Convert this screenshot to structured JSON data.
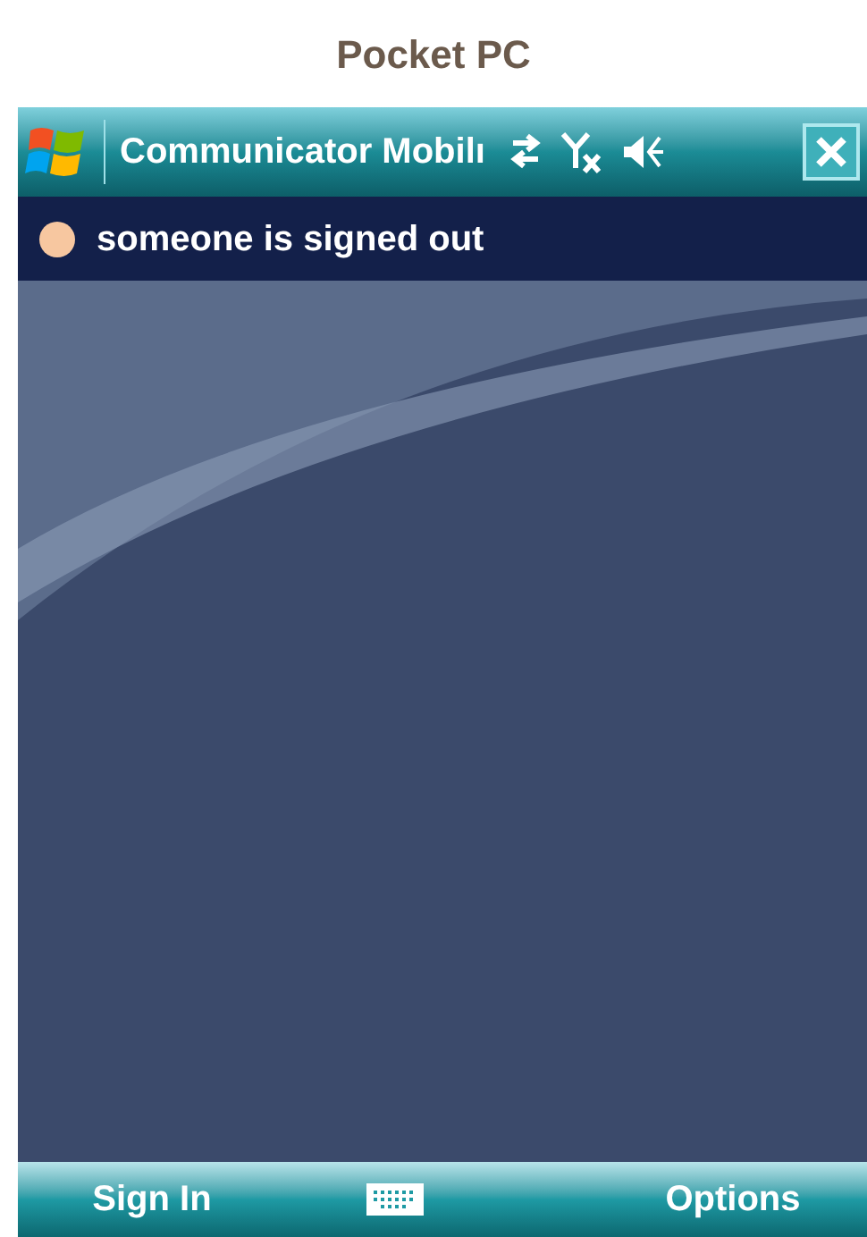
{
  "caption": "Pocket PC",
  "title_bar": {
    "title": "Communicator Mobilı"
  },
  "status": {
    "text": "someone is signed out"
  },
  "softkeys": {
    "left": "Sign In",
    "right": "Options"
  }
}
